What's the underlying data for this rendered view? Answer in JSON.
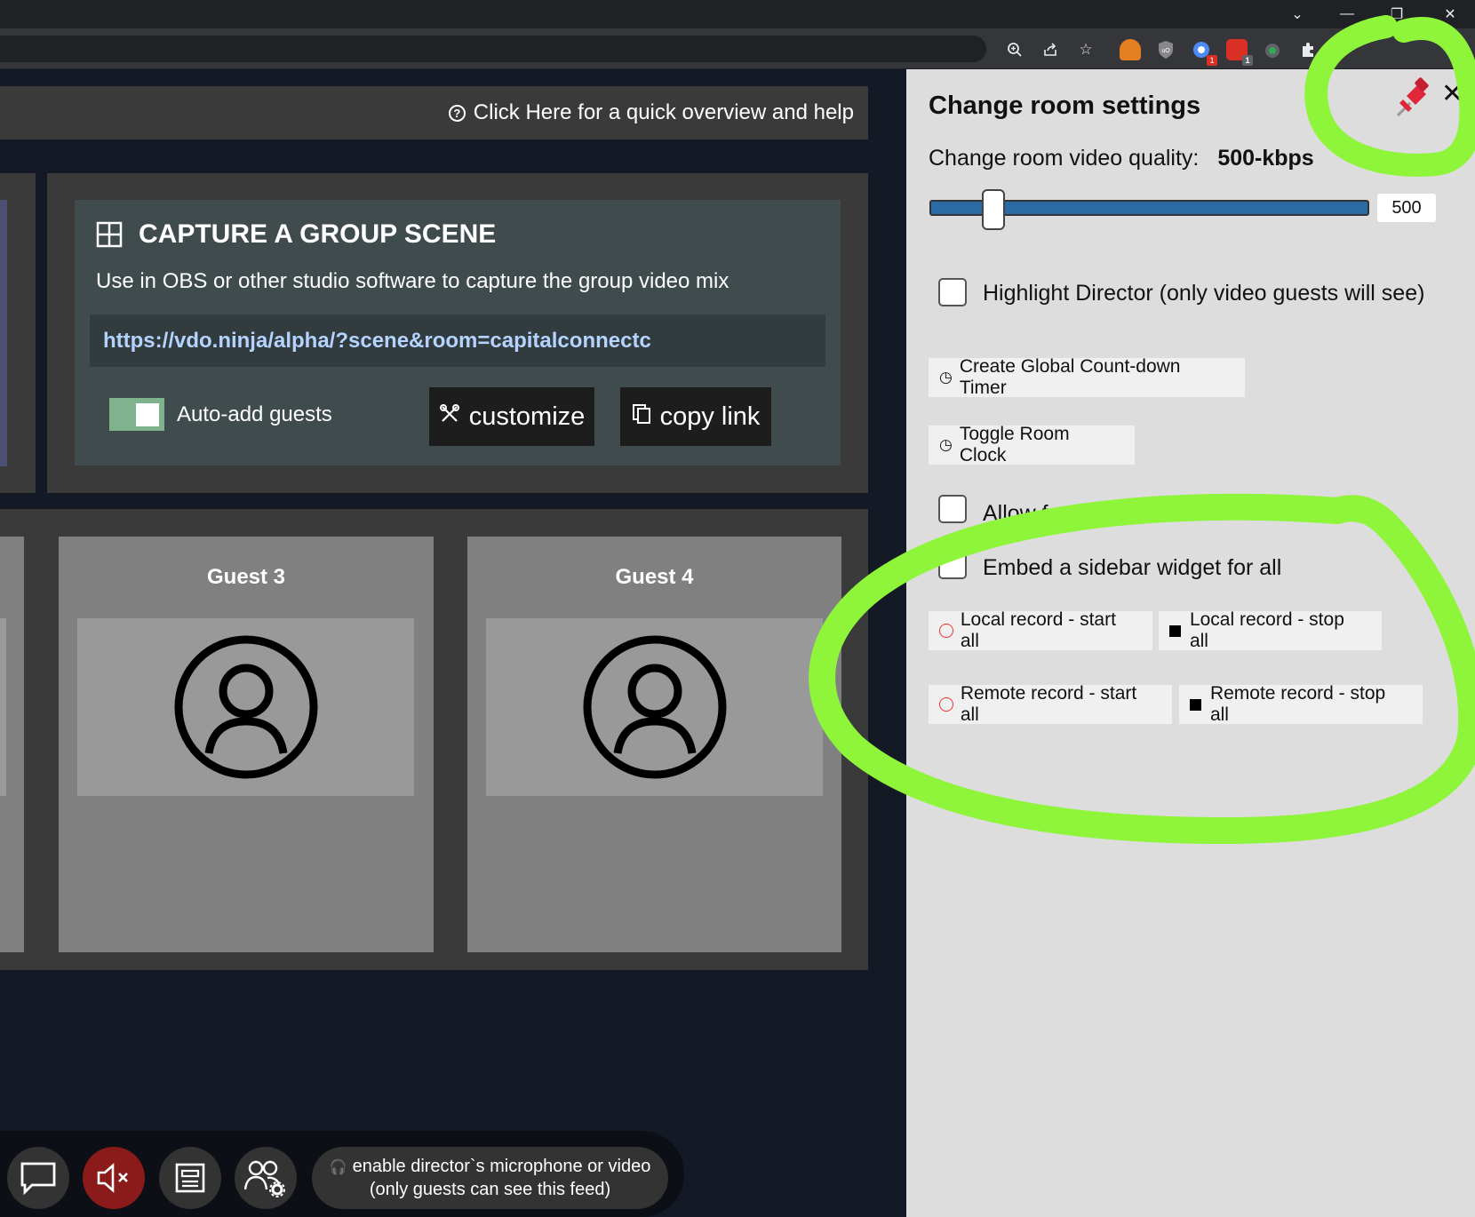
{
  "browser": {
    "window_controls": [
      "chevron-down",
      "minimize",
      "restore",
      "close"
    ],
    "extension_badges": {
      "ext_red_a": "1",
      "ext_red_b": "1"
    }
  },
  "main": {
    "help_link": "Click Here for a quick overview and help",
    "scene": {
      "title": "CAPTURE A GROUP SCENE",
      "description": "Use in OBS or other studio software to capture the group video mix",
      "url": "https://vdo.ninja/alpha/?scene&room=capitalconnectc",
      "auto_add_label": "Auto-add guests",
      "auto_add_enabled": true,
      "customize_label": "customize",
      "copy_label": "copy link"
    },
    "guests": [
      {
        "name": "Guest 3"
      },
      {
        "name": "Guest 4"
      }
    ],
    "bottom": {
      "mic_line1": "enable director`s microphone or video",
      "mic_line2": "(only guests can see this feed)"
    }
  },
  "panel": {
    "title": "Change room settings",
    "quality_label": "Change room video quality:",
    "quality_value": "500-kbps",
    "slider_value": "500",
    "highlight_label": "Highlight Director (only video guests will see)",
    "countdown_label": "Create Global Count-down Timer",
    "clock_label": "Toggle Room Clock",
    "allow_label": "Allow f",
    "sidebar_label": "Embed a sidebar widget for all",
    "local_start": "Local record - start all",
    "local_stop": "Local record - stop all",
    "remote_start": "Remote record - start all",
    "remote_stop": "Remote record - stop all"
  },
  "colors": {
    "annotation": "#8ef53a",
    "toggle_on": "#7fb38d",
    "url_text": "#b4d3ff",
    "slider_fill": "#2a6aa5",
    "record_circle": "#e33333"
  }
}
